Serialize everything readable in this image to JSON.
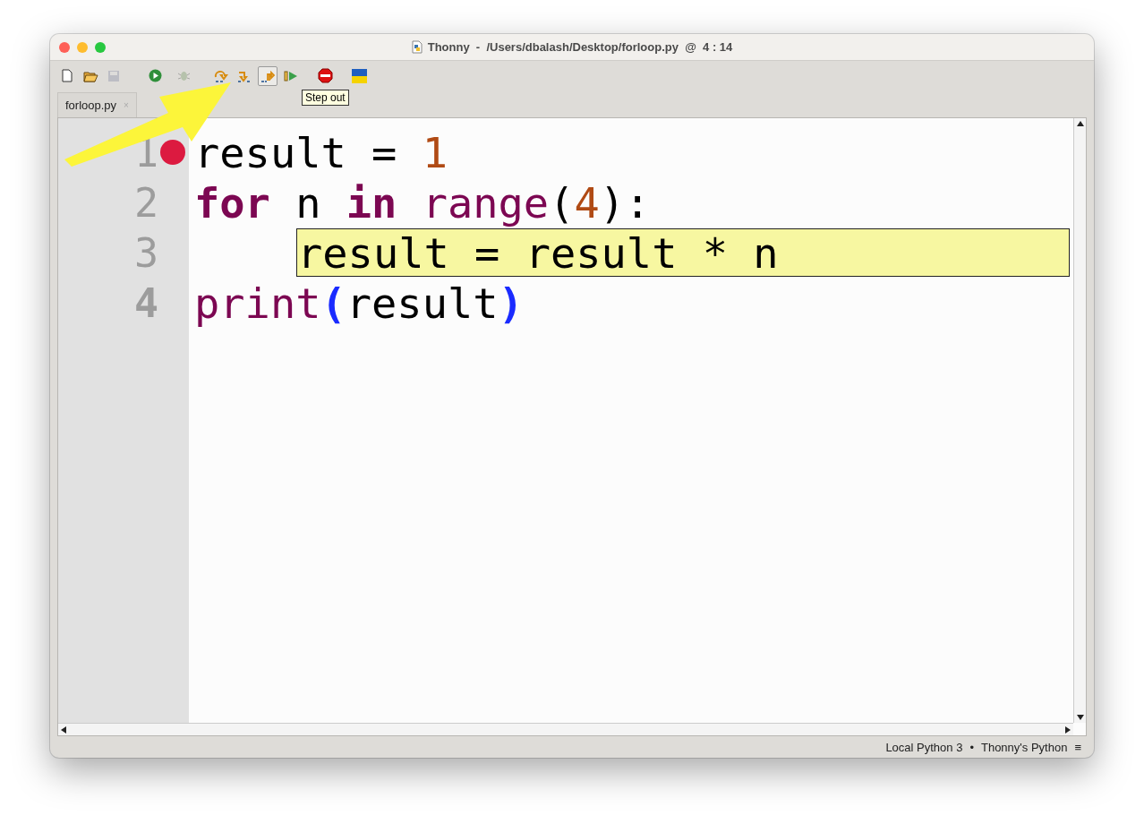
{
  "window": {
    "title": "Thonny  -  /Users/dbalash/Desktop/forloop.py  @  4 : 14"
  },
  "toolbar": [
    {
      "kind": "new",
      "disabled": false,
      "pressed": false
    },
    {
      "kind": "open",
      "disabled": false,
      "pressed": false
    },
    {
      "kind": "save",
      "disabled": true,
      "pressed": false
    },
    {
      "kind": "run",
      "disabled": false,
      "pressed": false
    },
    {
      "kind": "debug",
      "disabled": true,
      "pressed": false
    },
    {
      "kind": "step-over",
      "disabled": false,
      "pressed": false
    },
    {
      "kind": "step-into",
      "disabled": false,
      "pressed": false
    },
    {
      "kind": "step-out",
      "disabled": false,
      "pressed": true
    },
    {
      "kind": "resume",
      "disabled": false,
      "pressed": false
    },
    {
      "kind": "stop",
      "disabled": false,
      "pressed": false
    },
    {
      "kind": "flag",
      "disabled": false,
      "pressed": false
    }
  ],
  "tooltip": "Step out",
  "tabs": [
    {
      "label": "forloop.py",
      "close": "×",
      "selected": true
    }
  ],
  "editor": {
    "lines": [
      {
        "number": "1",
        "breakpoint": true,
        "current": false,
        "indented": false,
        "tokens": [
          {
            "kind": "name",
            "text": "result = "
          },
          {
            "kind": "number",
            "text": "1"
          }
        ]
      },
      {
        "number": "2",
        "breakpoint": false,
        "current": false,
        "indented": false,
        "tokens": [
          {
            "kind": "keyword",
            "text": "for"
          },
          {
            "kind": "name",
            "text": " n "
          },
          {
            "kind": "keyword",
            "text": "in"
          },
          {
            "kind": "builtin",
            "text": " range"
          },
          {
            "kind": "name",
            "text": "("
          },
          {
            "kind": "number",
            "text": "4"
          },
          {
            "kind": "name",
            "text": "):"
          }
        ]
      },
      {
        "number": "3",
        "breakpoint": false,
        "current": false,
        "indented": true,
        "tokens": [
          {
            "kind": "highlight",
            "text": "result = result * n"
          }
        ]
      },
      {
        "number": "4",
        "breakpoint": false,
        "current": true,
        "indented": false,
        "tokens": [
          {
            "kind": "builtin",
            "text": "print"
          },
          {
            "kind": "paren",
            "text": "("
          },
          {
            "kind": "name",
            "text": "result"
          },
          {
            "kind": "paren",
            "text": ")"
          }
        ]
      }
    ]
  },
  "status_bar": {
    "interpreter": "Local Python 3",
    "separator": "•",
    "python": "Thonny's Python",
    "menu": "≡"
  }
}
